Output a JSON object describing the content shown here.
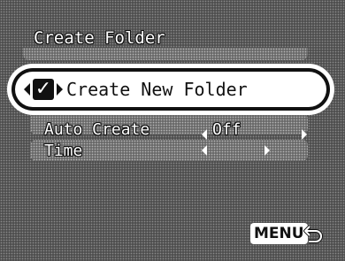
{
  "header": {
    "title": "Create Folder"
  },
  "menu": {
    "selected_item": {
      "label": "Create New Folder",
      "checked": true
    },
    "items": [
      {
        "label": "Auto Create",
        "value": "Off"
      },
      {
        "label": "Time",
        "value": ""
      }
    ]
  },
  "footer": {
    "menu_button": "MENU",
    "back_icon": "return-arrow-icon"
  },
  "colors": {
    "background": "#4f4f4f",
    "highlight": "#ffffff",
    "text": "#ffffff"
  }
}
